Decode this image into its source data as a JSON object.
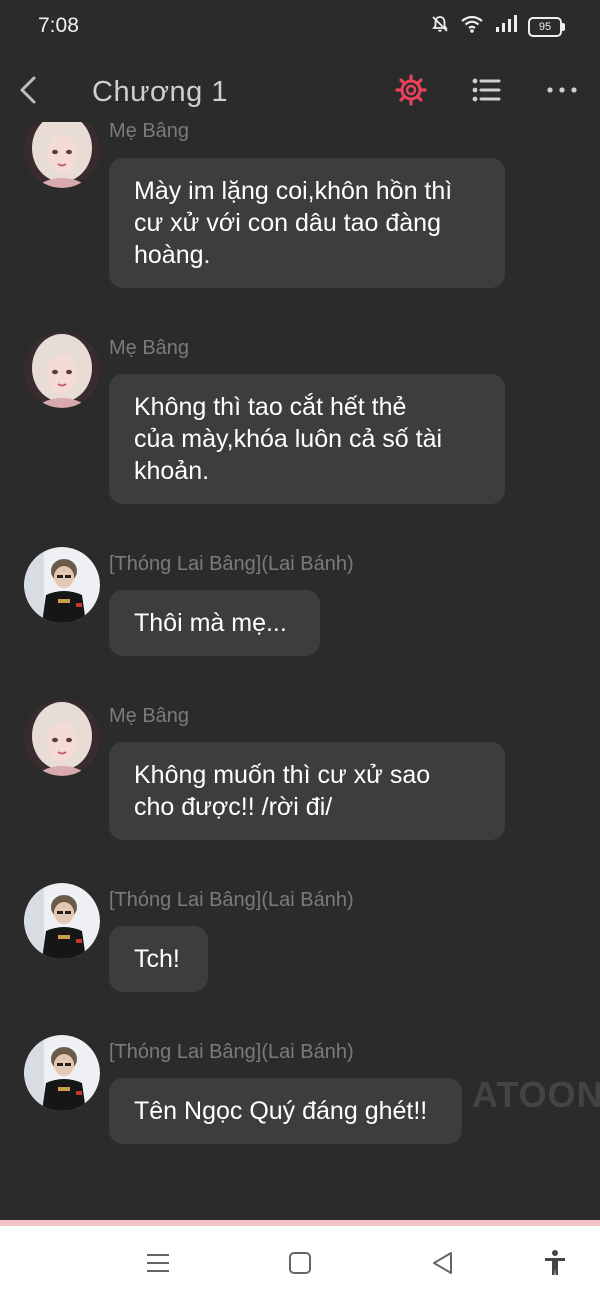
{
  "status_bar": {
    "time": "7:08",
    "battery": "95",
    "icons": [
      "mute-bell-icon",
      "wifi-icon",
      "signal-icon",
      "battery-icon"
    ]
  },
  "header": {
    "title": "Chương 1",
    "back_icon": "chevron-left-icon",
    "settings_icon": "gear-icon",
    "settings_color": "#e8425c",
    "list_icon": "list-icon",
    "more_icon": "more-dots-icon"
  },
  "messages": [
    {
      "sender": "Mẹ Bâng",
      "avatar": "woman",
      "lines": [
        "Mày im lặng coi,khôn hồn thì",
        "cư xử với con dâu tao đàng",
        "hoàng."
      ]
    },
    {
      "sender": "Mẹ Bâng",
      "avatar": "woman",
      "lines": [
        "Không thì tao cắt hết thẻ",
        "của mày,khóa luôn cả số tài",
        "khoản."
      ]
    },
    {
      "sender": "[Thóng Lai Bâng](Lai Bánh)",
      "avatar": "man",
      "lines": [
        "Thôi mà mẹ..."
      ]
    },
    {
      "sender": "Mẹ Bâng",
      "avatar": "woman",
      "lines": [
        "Không muốn thì cư xử sao",
        "cho được!! /rời đi/"
      ]
    },
    {
      "sender": "[Thóng Lai Bâng](Lai Bánh)",
      "avatar": "man",
      "lines": [
        "Tch!"
      ]
    },
    {
      "sender": "[Thóng Lai Bâng](Lai Bánh)",
      "avatar": "man",
      "lines": [
        "Tên Ngọc Quý đáng ghét!!"
      ]
    }
  ],
  "watermark": "ATOON",
  "nav_bar": {
    "icons": [
      "menu-lines-icon",
      "home-square-icon",
      "back-triangle-icon",
      "accessibility-icon"
    ]
  }
}
